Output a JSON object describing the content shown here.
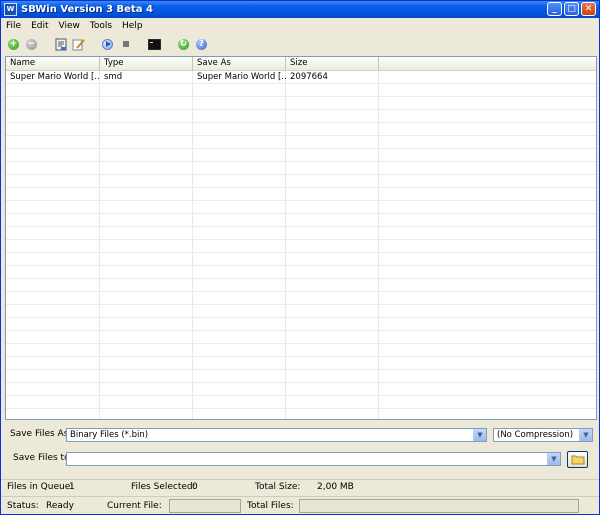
{
  "window": {
    "title": "SBWin Version 3 Beta 4",
    "icon_label": "W"
  },
  "menu": [
    "File",
    "Edit",
    "View",
    "Tools",
    "Help"
  ],
  "toolbar": {
    "icons": [
      "add-icon",
      "remove-icon",
      "properties-icon",
      "edit-icon",
      "play-icon",
      "stop-icon",
      "console-icon",
      "web-icon",
      "help-icon"
    ]
  },
  "list": {
    "columns": [
      "Name",
      "Type",
      "Save As",
      "Size"
    ],
    "rows": [
      {
        "name": "Super Mario World [...",
        "type": "smd",
        "save_as": "Super Mario World [...",
        "size": "2097664"
      }
    ]
  },
  "save_options": {
    "save_as_label": "Save Files As:",
    "save_as_value": "Binary Files (*.bin)",
    "compression_value": "(No Compression)",
    "save_to_label": "Save Files to:",
    "save_to_value": ""
  },
  "status_top": {
    "queue_label": "Files in Queue:",
    "queue_value": "1",
    "selected_label": "Files Selected:",
    "selected_value": "0",
    "total_size_label": "Total Size:",
    "total_size_value": "2,00 MB"
  },
  "status_bottom": {
    "status_label": "Status:",
    "status_value": "Ready",
    "current_file_label": "Current File:",
    "total_files_label": "Total Files:"
  },
  "colors": {
    "title_bar": "#0454e0",
    "window_bg": "#ece9d8",
    "border": "#7f9db9"
  }
}
